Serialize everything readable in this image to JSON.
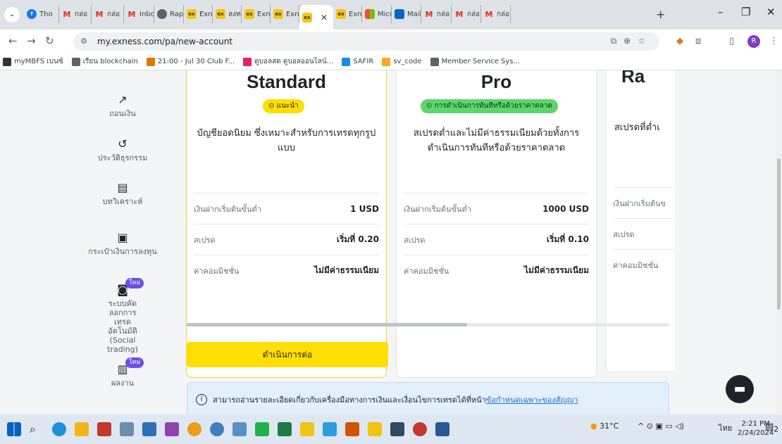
{
  "browser": {
    "tabs": [
      {
        "icon": "facebook-icon",
        "label": "Tho"
      },
      {
        "icon": "gmail-icon",
        "label": "กล่อ"
      },
      {
        "icon": "gmail-icon",
        "label": "กล่อ"
      },
      {
        "icon": "gmail-icon",
        "label": "Inbo"
      },
      {
        "icon": "chrome-icon",
        "label": "Rap"
      },
      {
        "icon": "exness-icon",
        "label": "Exne"
      },
      {
        "icon": "exness-icon",
        "label": "ลงทะ"
      },
      {
        "icon": "exness-icon",
        "label": "Exne"
      },
      {
        "icon": "exness-icon",
        "label": "Exne"
      },
      {
        "icon": "exness-icon",
        "label": ""
      },
      {
        "icon": "exness-icon",
        "label": "Exne"
      },
      {
        "icon": "microsoft-icon",
        "label": "Micr"
      },
      {
        "icon": "outlook-icon",
        "label": "Mail"
      },
      {
        "icon": "gmail-icon",
        "label": "กล่อ"
      },
      {
        "icon": "gmail-icon",
        "label": "กล่อ"
      },
      {
        "icon": "gmail-icon",
        "label": "กล่อ"
      }
    ],
    "url": "my.exness.com/pa/new-account",
    "avatar_letter": "R",
    "bookmarks": [
      {
        "label": "myMBFS เบนซ์",
        "color": "#333333"
      },
      {
        "label": "เรียน blockchain",
        "color": "#5f6368"
      },
      {
        "label": "21:00 - Jul 30 Club F...",
        "color": "#e37400"
      },
      {
        "label": "ดูบอลสด ดูบอลออนไลน์...",
        "color": "#e91e63"
      },
      {
        "label": "SAFIR",
        "color": "#1e88e5"
      },
      {
        "label": "sv_code",
        "color": "#f9a825"
      },
      {
        "label": "Member Service Sys...",
        "color": "#5f6368"
      }
    ]
  },
  "sidebar": {
    "items": [
      {
        "icon": "withdraw-icon",
        "glyph": "↗",
        "label": "ถอนเงิน"
      },
      {
        "icon": "history-icon",
        "glyph": "↺",
        "label": "ประวัติธุรกรรม"
      },
      {
        "icon": "analytics-icon",
        "glyph": "▤",
        "label": "บทวิเคราะห์"
      },
      {
        "icon": "wallet-icon",
        "glyph": "▣",
        "label": "กระเป๋าเงินการลงทุน"
      },
      {
        "icon": "social-trading-icon",
        "glyph": "◙",
        "label": "ระบบคัดลอกการเทรดอัตโนมัติ (Social trading)",
        "badge": "ใหม่"
      },
      {
        "icon": "performance-icon",
        "glyph": "▥",
        "label": "ผลงาน",
        "badge": "ใหม่"
      }
    ]
  },
  "accounts": [
    {
      "name": "Standard",
      "chip": "แนะนำ",
      "chip_style": "yellow",
      "description": "บัญชียอดนิยม ซึ่งเหมาะสำหรับการเทรดทุกรูปแบบ",
      "rows": [
        {
          "label": "เงินฝากเริ่มต้นขั้นต่ำ",
          "value": "1 USD"
        },
        {
          "label": "สเปรด",
          "value": "เริ่มที่ 0.20"
        },
        {
          "label": "ค่าคอมมิชชั่น",
          "value": "ไม่มีค่าธรรมเนียม"
        }
      ]
    },
    {
      "name": "Pro",
      "chip": "การดำเนินการทันทีหรือด้วยราคาตลาด",
      "chip_style": "green",
      "description": "สเปรดต่ำและไม่มีค่าธรรมเนียมด้วยทั้งการดำเนินการทันทีหรือด้วยราคาตลาด",
      "rows": [
        {
          "label": "เงินฝากเริ่มต้นขั้นต่ำ",
          "value": "1000 USD"
        },
        {
          "label": "สเปรด",
          "value": "เริ่มที่ 0.10"
        },
        {
          "label": "ค่าคอมมิชชั่น",
          "value": "ไม่มีค่าธรรมเนียม"
        }
      ]
    },
    {
      "name": "Ra",
      "description": "สเปรดที่ต่ำเ",
      "rows": [
        {
          "label": "เงินฝากเริ่มต้นข"
        },
        {
          "label": "สเปรด"
        },
        {
          "label": "ค่าคอมมิชชั่น"
        }
      ]
    }
  ],
  "continue_label": "ดำเนินการต่อ",
  "info": {
    "text": "สามารถอ่านรายละเอียดเกี่ยวกับเครื่องมือทางการเงินและเงื่อนไขการเทรดได้ที่หน้า",
    "link": "ข้อกำหนดเฉพาะของสัญญา"
  },
  "taskbar": {
    "temperature": "31°C",
    "language": "ไทย",
    "time": "2:21 PM",
    "date": "2/24/2024",
    "notification_count": "2"
  },
  "colors": {
    "accent_yellow": "#ffde02",
    "chip_green": "#5cd66b",
    "link_blue": "#1d6fd6"
  }
}
